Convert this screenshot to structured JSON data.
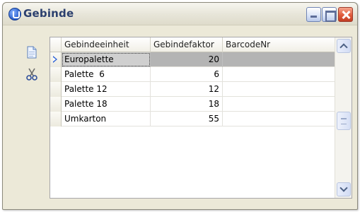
{
  "window": {
    "title": "Gebinde",
    "icon": "app-icon"
  },
  "toolbar": {
    "items": [
      {
        "name": "new-record-icon",
        "tooltip": ""
      },
      {
        "name": "cut-icon",
        "tooltip": ""
      }
    ]
  },
  "grid": {
    "columns": [
      "Gebindeeinheit",
      "Gebindefaktor",
      "BarcodeNr"
    ],
    "rows": [
      {
        "einheit": "Europalette",
        "faktor": "20",
        "barcode": "",
        "selected": true
      },
      {
        "einheit": "Palette  6",
        "faktor": "6",
        "barcode": ""
      },
      {
        "einheit": "Palette 12",
        "faktor": "12",
        "barcode": ""
      },
      {
        "einheit": "Palette 18",
        "faktor": "18",
        "barcode": ""
      },
      {
        "einheit": "Umkarton",
        "faktor": "55",
        "barcode": ""
      }
    ]
  },
  "colors": {
    "title_text": "#2b3f6e",
    "selected_row": "#b4b4b4",
    "row_indicator": "#2d62d6"
  }
}
